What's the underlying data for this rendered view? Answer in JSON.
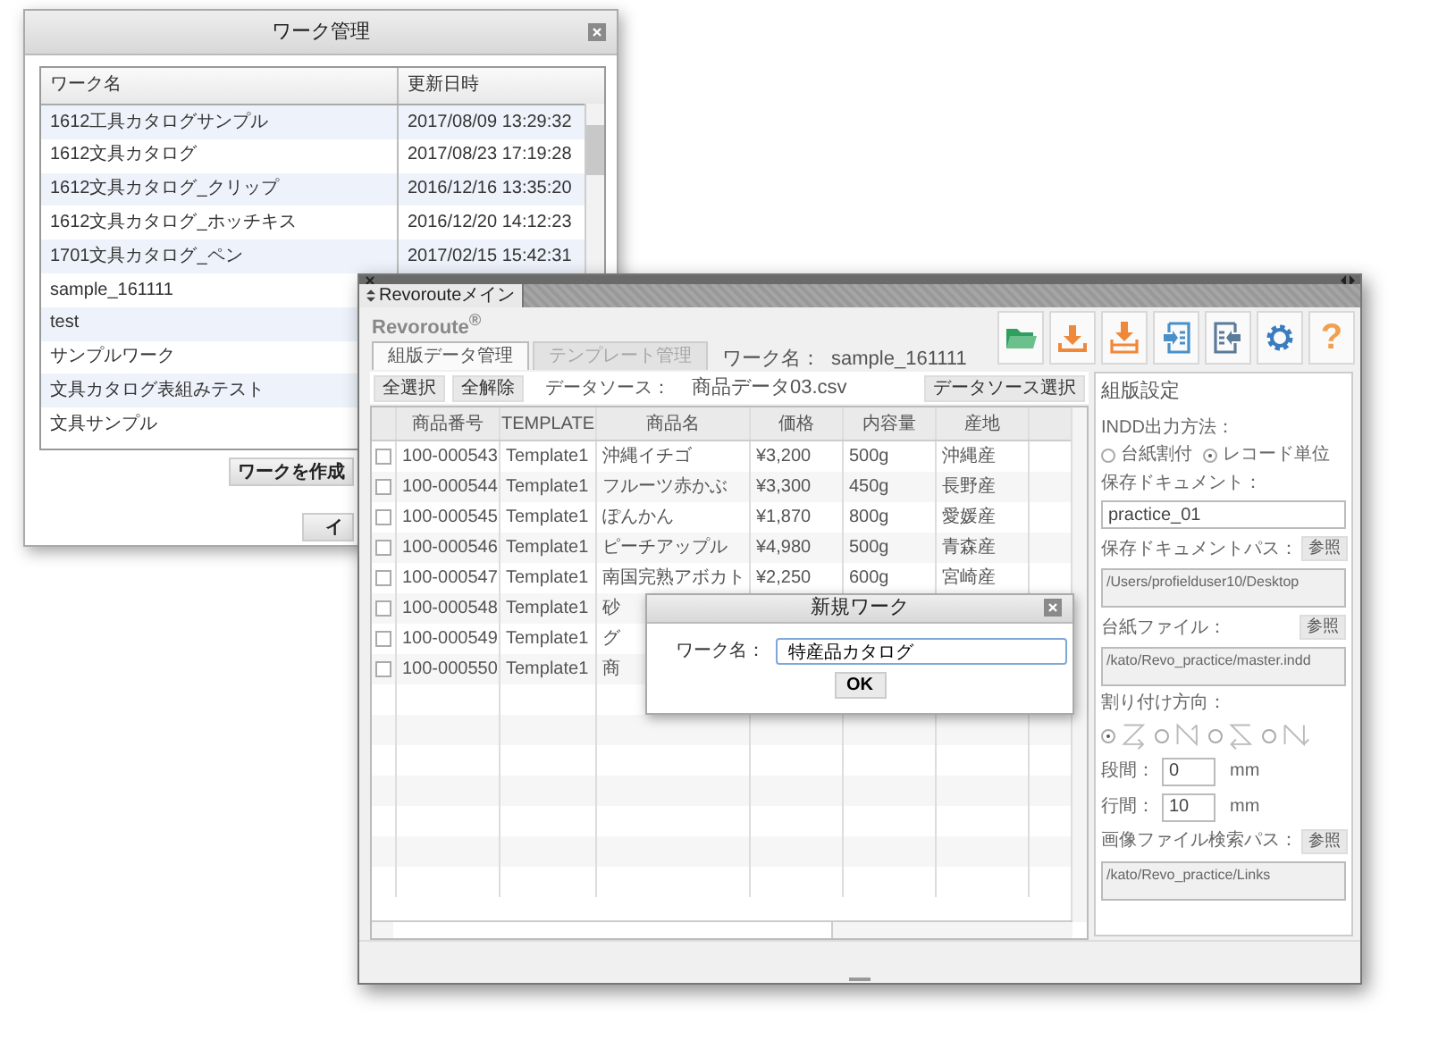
{
  "work_window": {
    "title": "ワーク管理",
    "columns": [
      "ワーク名",
      "更新日時"
    ],
    "rows": [
      {
        "name": "1612工具カタログサンプル",
        "updated": "2017/08/09 13:29:32"
      },
      {
        "name": "1612文具カタログ",
        "updated": "2017/08/23 17:19:28"
      },
      {
        "name": "1612文具カタログ_クリップ",
        "updated": "2016/12/16 13:35:20"
      },
      {
        "name": "1612文具カタログ_ホッチキス",
        "updated": "2016/12/20 14:12:23"
      },
      {
        "name": "1701文具カタログ_ペン",
        "updated": "2017/02/15 15:42:31"
      },
      {
        "name": "sample_161111"
      },
      {
        "name": "test"
      },
      {
        "name": "サンプルワーク"
      },
      {
        "name": "文具カタログ表組みテスト"
      },
      {
        "name": "文具サンプル"
      }
    ],
    "create_button": "ワークを作成",
    "second_button": "イ"
  },
  "main_window": {
    "title": "Revorouteメイン",
    "logo": "Revoroute$^{®}$",
    "toolbar": [
      {
        "kind": "folder"
      },
      {
        "kind": "download"
      },
      {
        "kind": "tray"
      },
      {
        "kind": "import"
      },
      {
        "kind": "export"
      },
      {
        "kind": "gear"
      },
      {
        "kind": "help",
        "glyph": "?"
      }
    ],
    "tabs": [
      {
        "label": "組版データ管理",
        "selected": true,
        "disabled": false
      },
      {
        "label": "テンプレート管理",
        "selected": false,
        "disabled": true
      }
    ],
    "work_name_label": "ワーク名：",
    "work_name": "sample_161111",
    "select_all": "全選択",
    "deselect_all": "全解除",
    "data_source_label": "データソース：",
    "data_source": "商品データ03.csv",
    "data_source_button": "データソース選択",
    "table": {
      "columns": [
        "商品番号",
        "TEMPLATE",
        "商品名",
        "価格",
        "内容量",
        "産地"
      ],
      "rows": [
        {
          "checked": false,
          "cells": [
            "100-000543",
            "Template1",
            "沖縄イチゴ",
            "¥3,200",
            "500g",
            "沖縄産"
          ]
        },
        {
          "checked": false,
          "cells": [
            "100-000544",
            "Template1",
            "フルーツ赤かぶ",
            "¥3,300",
            "450g",
            "長野産"
          ]
        },
        {
          "checked": false,
          "cells": [
            "100-000545",
            "Template1",
            "ぽんかん",
            "¥1,870",
            "800g",
            "愛媛産"
          ]
        },
        {
          "checked": false,
          "cells": [
            "100-000546",
            "Template1",
            "ピーチアップル",
            "¥4,980",
            "500g",
            "青森産"
          ]
        },
        {
          "checked": false,
          "cells": [
            "100-000547",
            "Template1",
            "南国完熟アボカト",
            "¥2,250",
            "600g",
            "宮崎産"
          ]
        },
        {
          "checked": false,
          "cells": [
            "100-000548",
            "Template1",
            "砂"
          ]
        },
        {
          "checked": false,
          "cells": [
            "100-000549",
            "Template1",
            "グ"
          ]
        },
        {
          "checked": false,
          "cells": [
            "100-000550",
            "Template1",
            "商"
          ]
        }
      ]
    },
    "settings": {
      "title": "組版設定",
      "output_label": "INDD出力方法：",
      "output_modes": [
        {
          "label": "台紙割付",
          "selected": false
        },
        {
          "label": "レコード単位",
          "selected": true
        }
      ],
      "doc_label": "保存ドキュメント：",
      "doc_value": "practice_01",
      "paths": [
        {
          "label": "保存ドキュメントパス：",
          "button": "参照",
          "value": "/Users/profielduser10/Desktop"
        },
        {
          "label": "台紙ファイル：",
          "button": "参照",
          "value": "/kato/Revo_practice/master.indd"
        }
      ],
      "direction_label": "割り付け方向：",
      "directions": [
        {
          "kind": "z",
          "selected": true
        },
        {
          "kind": "n",
          "selected": false
        },
        {
          "kind": "s",
          "selected": false
        },
        {
          "kind": "rn",
          "selected": false
        }
      ],
      "spacing": [
        {
          "label": "段間：",
          "value": "0",
          "unit": "mm"
        },
        {
          "label": "行間：",
          "value": "10",
          "unit": "mm"
        }
      ],
      "image_path": {
        "label": "画像ファイル検索パス：",
        "button": "参照",
        "value": "/kato/Revo_practice/Links"
      }
    }
  },
  "dialog": {
    "title": "新規ワーク",
    "label": "ワーク名：",
    "value": "特産品カタログ",
    "button": "OK"
  }
}
